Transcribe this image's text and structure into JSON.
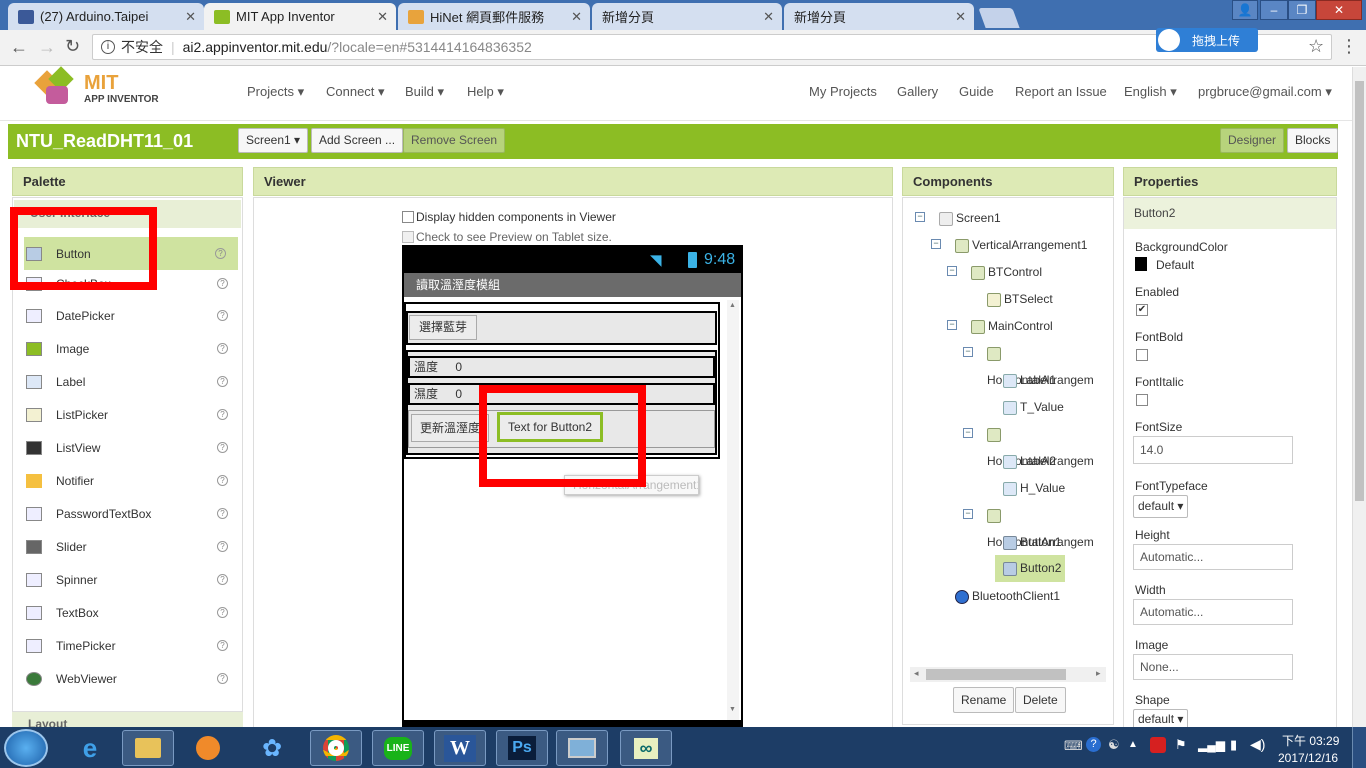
{
  "browser": {
    "tabs": [
      {
        "title": "(27) Arduino.Taipei",
        "color": "#3b5998"
      },
      {
        "title": "MIT App Inventor",
        "color": "#8cbd24"
      },
      {
        "title": "HiNet 網頁郵件服務",
        "color": "#e8a33c"
      },
      {
        "title": "新增分頁",
        "color": "#cccccc"
      },
      {
        "title": "新增分頁",
        "color": "#cccccc"
      }
    ],
    "security": "不安全",
    "url_host": "ai2.appinventor.mit.edu",
    "url_path": "/?locale=en#5314414164836352",
    "ext_button": "拖拽上传",
    "win_min": "–",
    "win_max": "❐",
    "win_close": "✕",
    "user_icon": "👤"
  },
  "app": {
    "logo_title": "MIT",
    "logo_sub": "APP INVENTOR",
    "menus": [
      "Projects ▾",
      "Connect ▾",
      "Build ▾",
      "Help ▾"
    ],
    "right_menus": [
      "My Projects",
      "Gallery",
      "Guide",
      "Report an Issue",
      "English ▾",
      "prgbruce@gmail.com ▾"
    ]
  },
  "project": {
    "name": "NTU_ReadDHT11_01",
    "screen_select": "Screen1 ▾",
    "add_screen": "Add Screen ...",
    "remove_screen": "Remove Screen",
    "designer": "Designer",
    "blocks": "Blocks"
  },
  "palette": {
    "header": "Palette",
    "category": "User Interface",
    "items": [
      "Button",
      "CheckBox",
      "DatePicker",
      "Image",
      "Label",
      "ListPicker",
      "ListView",
      "Notifier",
      "PasswordTextBox",
      "Slider",
      "Spinner",
      "TextBox",
      "TimePicker",
      "WebViewer"
    ],
    "footer": "Layout"
  },
  "viewer": {
    "header": "Viewer",
    "hidden_label": "Display hidden components in Viewer",
    "tablet_label": "Check to see Preview on Tablet size.",
    "time": "9:48",
    "app_title": "讀取溫溼度模組",
    "select_bt": "選擇藍芽",
    "temp_label": "溫度",
    "temp_value": "0",
    "hum_label": "濕度",
    "hum_value": "0",
    "update_btn": "更新溫溼度",
    "button2_text": "Text for Button2",
    "drag_ghost": "HorizontalArrangement1"
  },
  "components": {
    "header": "Components",
    "tree": [
      {
        "name": "Screen1",
        "level": 0
      },
      {
        "name": "VerticalArrangement1",
        "level": 1
      },
      {
        "name": "BTControl",
        "level": 2
      },
      {
        "name": "BTSelect",
        "level": 3
      },
      {
        "name": "MainControl",
        "level": 2
      },
      {
        "name": "HorizontalArrangem",
        "level": 3
      },
      {
        "name": "Label1",
        "level": 4
      },
      {
        "name": "T_Value",
        "level": 4
      },
      {
        "name": "HorizontalArrangem",
        "level": 3
      },
      {
        "name": "Label2",
        "level": 4
      },
      {
        "name": "H_Value",
        "level": 4
      },
      {
        "name": "HorizontalArrangem",
        "level": 3
      },
      {
        "name": "Button1",
        "level": 4
      },
      {
        "name": "Button2",
        "level": 4
      },
      {
        "name": "BluetoothClient1",
        "level": 1
      }
    ],
    "rename": "Rename",
    "delete": "Delete"
  },
  "properties": {
    "header": "Properties",
    "component": "Button2",
    "bg_label": "BackgroundColor",
    "bg_value": "Default",
    "enabled_label": "Enabled",
    "fontbold_label": "FontBold",
    "fontitalic_label": "FontItalic",
    "fontsize_label": "FontSize",
    "fontsize_value": "14.0",
    "typeface_label": "FontTypeface",
    "typeface_value": "default ▾",
    "height_label": "Height",
    "height_value": "Automatic...",
    "width_label": "Width",
    "width_value": "Automatic...",
    "image_label": "Image",
    "image_value": "None...",
    "shape_label": "Shape",
    "shape_value": "default ▾"
  },
  "taskbar": {
    "time": "下午 03:29",
    "date": "2017/12/16",
    "word": "W",
    "ps": "Ps",
    "line": "LINE",
    "arduino": "∞"
  }
}
